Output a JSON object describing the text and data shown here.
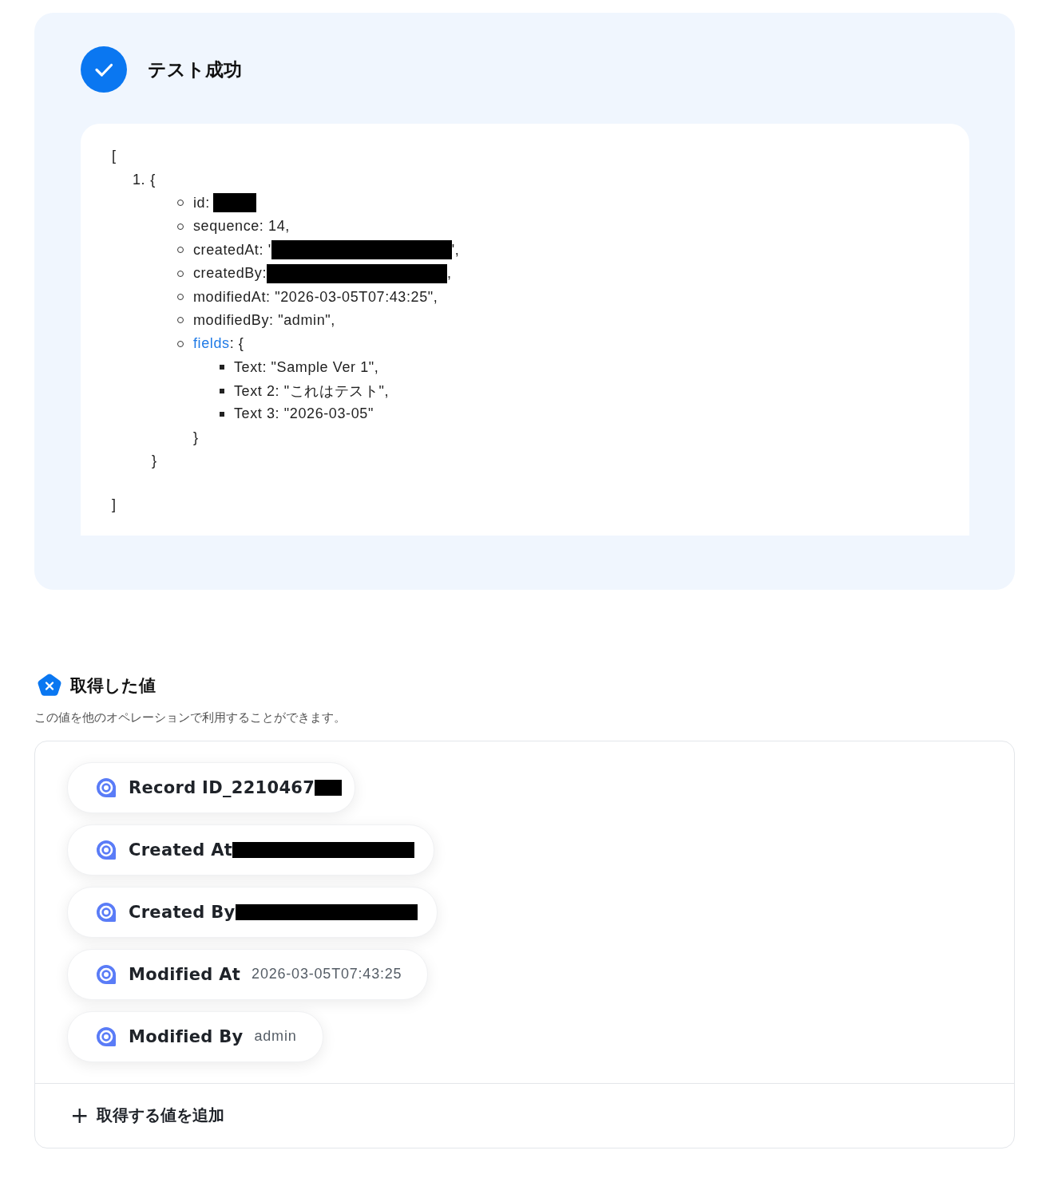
{
  "result": {
    "title": "テスト成功",
    "code": {
      "open": "[",
      "close": "]",
      "items": [
        {
          "marker": "1.",
          "open": "{",
          "close": "}",
          "props": [
            {
              "text": "id:",
              "redacted": true
            },
            {
              "text": "sequence: 14,"
            },
            {
              "text": "createdAt: '",
              "redacted": true,
              "suffix": "',"
            },
            {
              "text": "createdBy:",
              "redacted": true,
              "suffix": ","
            },
            {
              "text": "modifiedAt: \"2026-03-05T07:43:25\","
            },
            {
              "text": "modifiedBy: \"admin\","
            },
            {
              "link": "fields",
              "text": ": {",
              "close": "}",
              "children": [
                {
                  "text": "Text: \"Sample Ver 1\","
                },
                {
                  "text": "Text 2: \"これはテスト\","
                },
                {
                  "text": "Text 3: \"2026-03-05\""
                }
              ]
            }
          ]
        }
      ]
    }
  },
  "values": {
    "title": "取得した値",
    "description": "この値を他のオペレーションで利用することができます。",
    "chips": [
      {
        "label": "Record ID_2210467",
        "redacted": true
      },
      {
        "label": "Created At",
        "redacted": true
      },
      {
        "label": "Created By",
        "redacted": true
      },
      {
        "label": "Modified At",
        "value": "2026-03-05T07:43:25"
      },
      {
        "label": "Modified By",
        "value": "admin"
      }
    ],
    "add_button": {
      "icon": "+",
      "label": "取得する値を追加"
    }
  }
}
